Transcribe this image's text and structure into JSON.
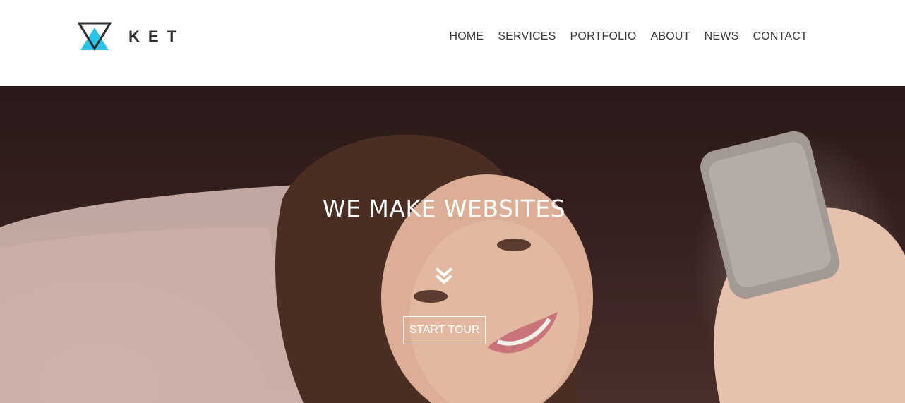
{
  "brand": {
    "name": "KET",
    "logo_icon": "triangle-logo-icon",
    "accent_color": "#29c4e6",
    "dark_color": "#2f2f2f"
  },
  "nav": {
    "items": [
      {
        "label": "HOME"
      },
      {
        "label": "SERVICES"
      },
      {
        "label": "PORTFOLIO"
      },
      {
        "label": "ABOUT"
      },
      {
        "label": "NEWS"
      },
      {
        "label": "CONTACT"
      }
    ]
  },
  "hero": {
    "title": "WE MAKE WEBSITES",
    "scroll_icon": "double-chevron-down-icon",
    "cta_label": "START TOUR",
    "background": "photo-woman-with-phone"
  }
}
